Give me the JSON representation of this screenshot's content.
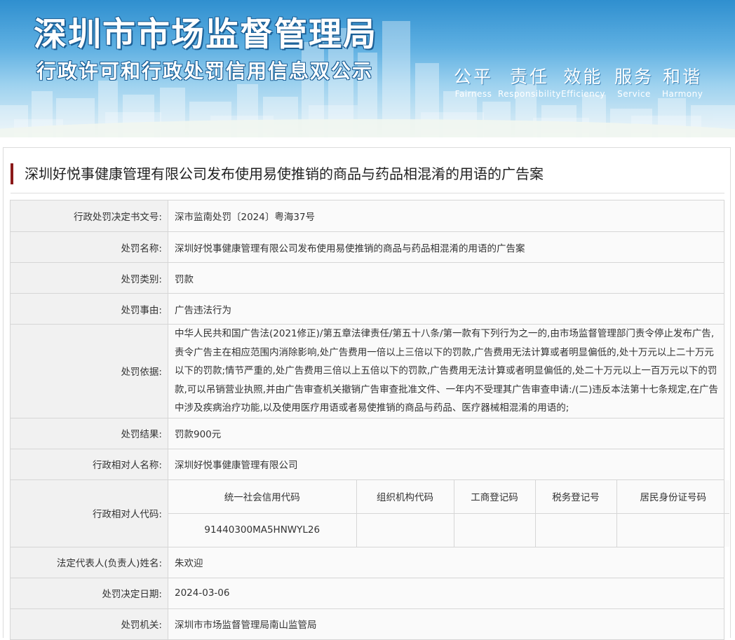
{
  "header": {
    "agency": "深圳市市场监督管理局",
    "subtitle": "行政许可和行政处罚信用信息双公示",
    "slogans": [
      {
        "cn": "公平",
        "en": "Fairness"
      },
      {
        "cn": "责任",
        "en": "Responsibility"
      },
      {
        "cn": "效能",
        "en": "Efficiency"
      },
      {
        "cn": "服务",
        "en": "Service"
      },
      {
        "cn": "和谐",
        "en": "Harmony"
      }
    ]
  },
  "case_title": "深圳好悦事健康管理有限公司发布使用易使推销的商品与药品相混淆的用语的广告案",
  "rows": {
    "decision_no": {
      "label": "行政处罚决定书文号:",
      "value": "深市监南处罚〔2024〕粤海37号"
    },
    "penalty_name": {
      "label": "处罚名称:",
      "value": "深圳好悦事健康管理有限公司发布使用易使推销的商品与药品相混淆的用语的广告案"
    },
    "penalty_type": {
      "label": "处罚类别:",
      "value": "罚款"
    },
    "penalty_reason": {
      "label": "处罚事由:",
      "value": "广告违法行为"
    },
    "penalty_basis": {
      "label": "处罚依据:",
      "value": "中华人民共和国广告法(2021修正)/第五章法律责任/第五十八条/第一款有下列行为之一的,由市场监督管理部门责令停止发布广告,责令广告主在相应范围内消除影响,处广告费用一倍以上三倍以下的罚款,广告费用无法计算或者明显偏低的,处十万元以上二十万元以下的罚款;情节严重的,处广告费用三倍以上五倍以下的罚款,广告费用无法计算或者明显偏低的,处二十万元以上一百万元以下的罚款,可以吊销营业执照,并由广告审查机关撤销广告审查批准文件、一年内不受理其广告审查申请:/(二)违反本法第十七条规定,在广告中涉及疾病治疗功能,以及使用医疗用语或者易使推销的商品与药品、医疗器械相混淆的用语的;"
    },
    "penalty_result": {
      "label": "处罚结果:",
      "value": "罚款900元"
    },
    "party_name": {
      "label": "行政相对人名称:",
      "value": "深圳好悦事健康管理有限公司"
    },
    "party_code": {
      "label": "行政相对人代码:",
      "headers": [
        "统一社会信用代码",
        "组织机构代码",
        "工商登记码",
        "税务登记号",
        "居民身份证号码"
      ],
      "values": [
        "91440300MA5HNWYL26",
        "",
        "",
        "",
        ""
      ]
    },
    "legal_rep": {
      "label": "法定代表人(负责人)姓名:",
      "value": "朱欢迎"
    },
    "decision_date": {
      "label": "处罚决定日期:",
      "value": "2024-03-06"
    },
    "authority": {
      "label": "处罚机关:",
      "value": "深圳市市场监督管理局南山监管局"
    }
  }
}
